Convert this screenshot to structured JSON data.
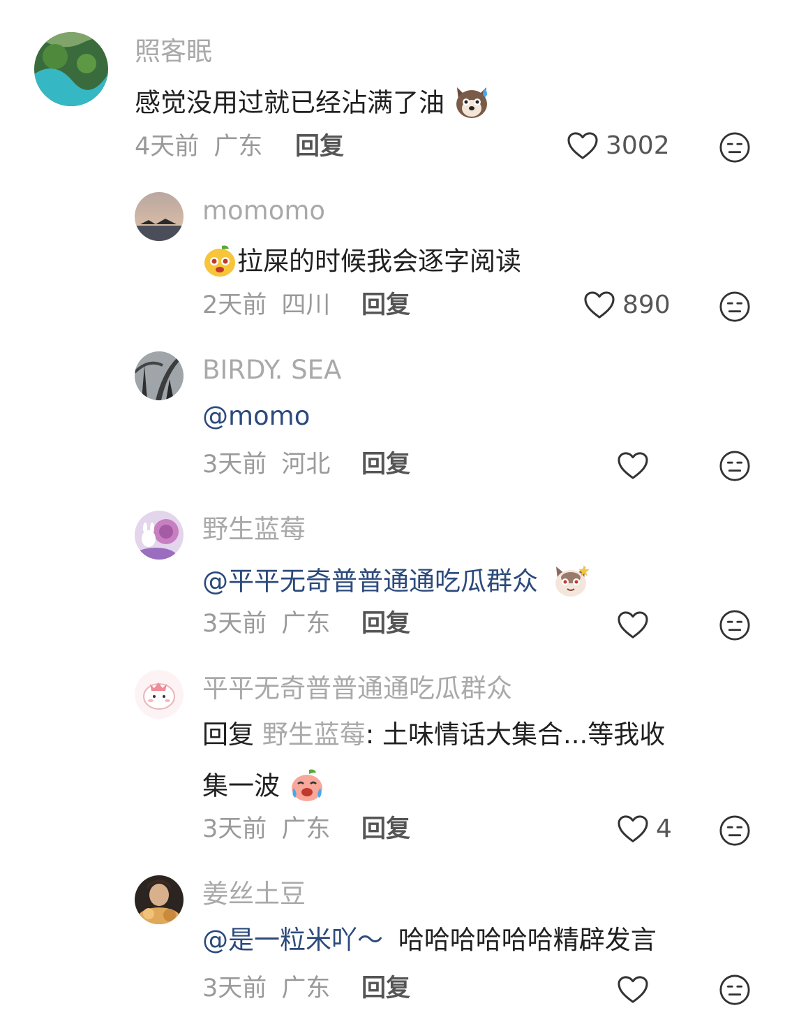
{
  "comments": [
    {
      "name": "照客眠",
      "text": "感觉没用过就已经沾满了油",
      "emoji": "dog-sweat-emoji",
      "time": "4天前",
      "location": "广东",
      "reply_label": "回复",
      "likes": "3002"
    },
    {
      "name": "momomo",
      "emoji": "mango-face-emoji",
      "text": "拉屎的时候我会逐字阅读",
      "time": "2天前",
      "location": "四川",
      "reply_label": "回复",
      "likes": "890"
    },
    {
      "name": "BIRDY. SEA",
      "mention": "@momo",
      "time": "3天前",
      "location": "河北",
      "reply_label": "回复",
      "likes": ""
    },
    {
      "name": "野生蓝莓",
      "mention": "@平平无奇普普通通吃瓜群众",
      "emoji": "cat-wink-emoji",
      "time": "3天前",
      "location": "广东",
      "reply_label": "回复",
      "likes": ""
    },
    {
      "name": "平平无奇普普通通吃瓜群众",
      "reply_prefix": "回复",
      "reply_to": "野生蓝莓",
      "text_line1": ": 土味情话大集合...等我收",
      "text_line2": "集一波",
      "emoji": "peach-crying-emoji",
      "time": "3天前",
      "location": "广东",
      "reply_label": "回复",
      "likes": "4"
    },
    {
      "name": "姜丝土豆",
      "mention": "@是一粒米吖～",
      "text": "哈哈哈哈哈哈精辟发言",
      "time": "3天前",
      "location": "广东",
      "reply_label": "回复",
      "likes": ""
    }
  ],
  "colors": {
    "mention": "#2c4a7c",
    "name": "#a9a9a9",
    "meta": "#9a9a9a"
  }
}
